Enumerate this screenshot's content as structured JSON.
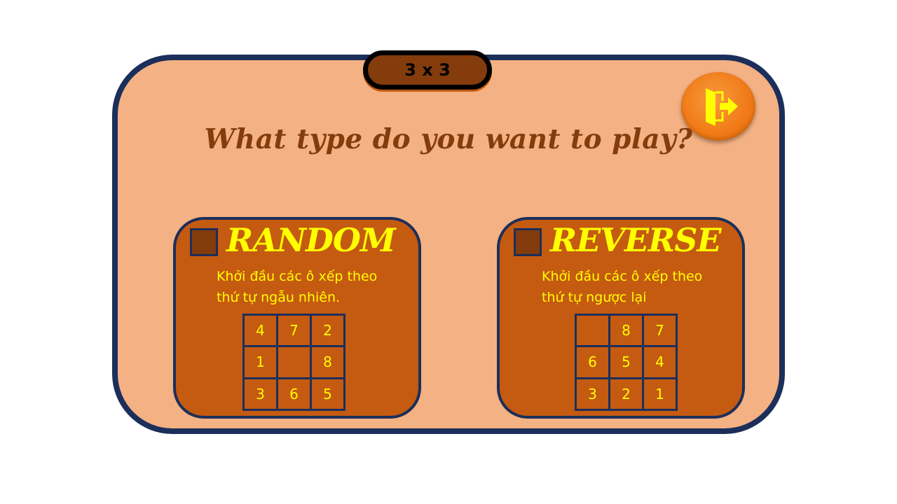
{
  "header": {
    "board_size": "3 x 3",
    "question": "What type do you want to play?"
  },
  "exit_button": {
    "icon": "exit-door-arrow-icon",
    "color": "#f07a16",
    "icon_color": "#ffff00"
  },
  "modes": [
    {
      "title": "RANDOM",
      "description": "Khởi đầu các ô xếp theo\nthứ tự ngẫu nhiên.",
      "checked": false,
      "tiles": [
        "4",
        "7",
        "2",
        "1",
        "",
        "8",
        "3",
        "6",
        "5"
      ]
    },
    {
      "title": "REVERSE",
      "description": "Khởi đầu các ô xếp theo\nthứ tự ngược lại",
      "checked": false,
      "tiles": [
        "",
        "8",
        "7",
        "6",
        "5",
        "4",
        "3",
        "2",
        "1"
      ]
    }
  ],
  "colors": {
    "panel": "#f4b183",
    "panel_border": "#1b2f5a",
    "card": "#c55a11",
    "title_text": "#ffff00",
    "question_text": "#843c0c"
  }
}
